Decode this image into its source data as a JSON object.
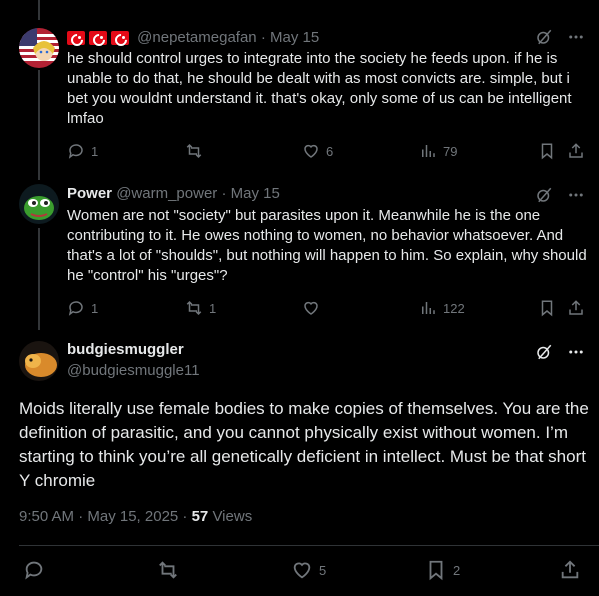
{
  "tweets": [
    {
      "display_name": "",
      "handle": "@nepetamegafan",
      "date": "May 15",
      "text": "he should control urges to integrate into the society he feeds upon. if he is unable to do that, he should be dealt with as most convicts are. simple, but i bet you wouldnt understand it. that's okay, only some of us can be intelligent lmfao",
      "replies": "1",
      "reposts": "",
      "likes": "6",
      "views": "79"
    },
    {
      "display_name": "Power",
      "handle": "@warm_power",
      "date": "May 15",
      "text": "Women are not \"society\" but parasites upon it. Meanwhile he is the one contributing to it. He owes nothing to women, no behavior whatsoever. And that's a lot of \"shoulds\", but nothing will happen to him. So explain, why should he \"control\" his \"urges\"?",
      "replies": "1",
      "reposts": "1",
      "likes": "",
      "views": "122"
    }
  ],
  "main": {
    "display_name": "budgiesmuggler",
    "handle": "@budgiesmuggle11",
    "text": "Moids literally use female bodies to make copies of themselves. You are the definition of parasitic, and you cannot physically exist without women. I’m starting to think you’re all genetically deficient in intellect. Must be that short Y chromie",
    "time": "9:50 AM · May 15, 2025 · ",
    "views_count": "57",
    "views_label": " Views",
    "replies": "",
    "reposts": "",
    "likes": "5",
    "bookmarks": "2"
  },
  "separator": "·",
  "colors": {
    "background": "#000000",
    "text": "#e7e9ea",
    "muted": "#71767b",
    "divider": "#2f3336"
  }
}
